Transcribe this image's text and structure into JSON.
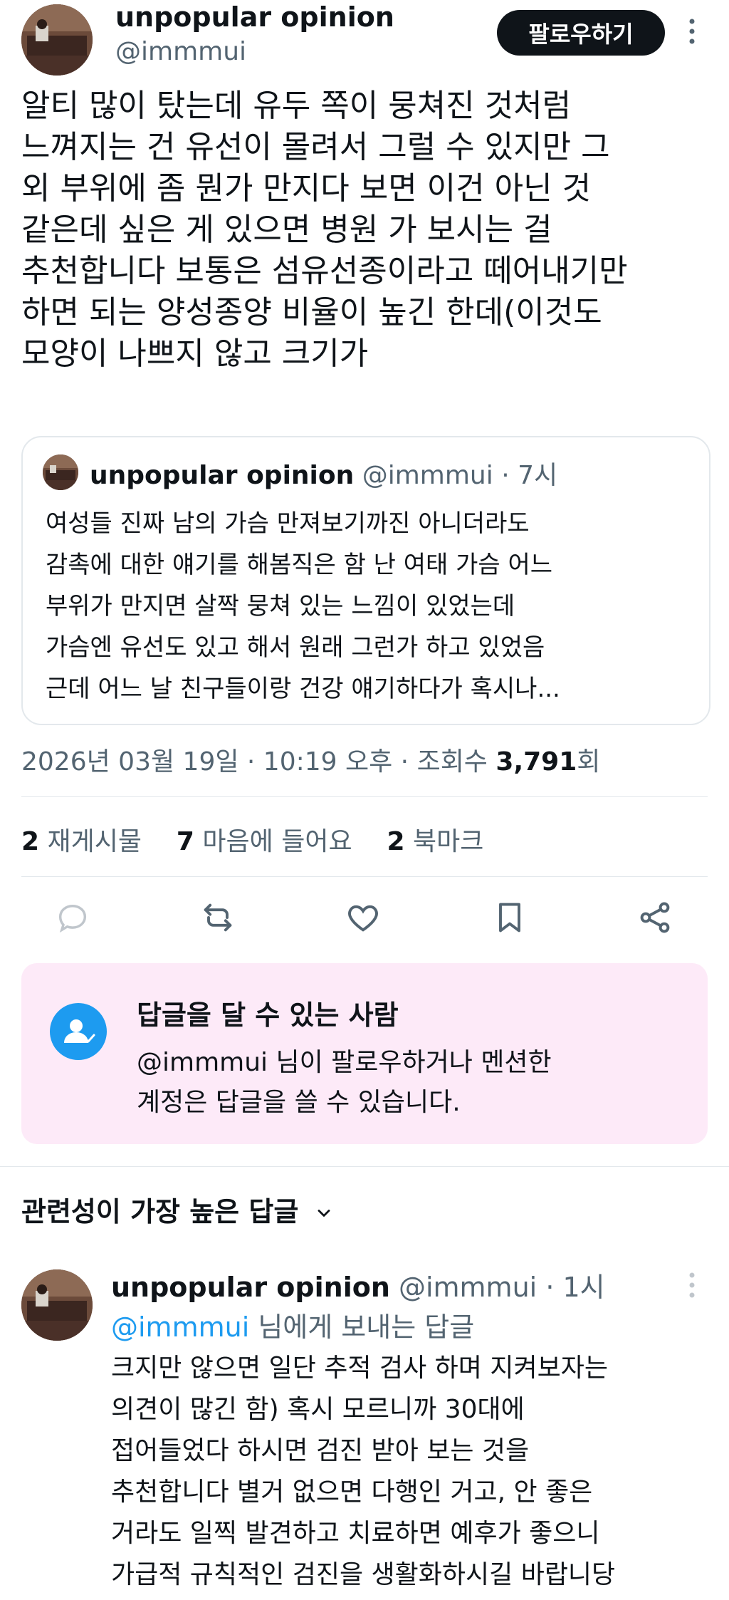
{
  "post": {
    "author_name": "unpopular opinion",
    "author_handle": "@immmui",
    "follow_label": "팔로우하기",
    "text_lines": [
      "알티 많이 탔는데 유두 쪽이 뭉쳐진 것처럼",
      "느껴지는 건 유선이 몰려서 그럴 수 있지만 그",
      "외 부위에 좀 뭔가 만지다 보면 이건 아닌 것",
      "같은데 싶은 게 있으면 병원 가 보시는 걸",
      "추천합니다 보통은 섬유선종이라고 떼어내기만",
      "하면 되는 양성종양 비율이 높긴 한데(이것도",
      "모양이 나쁘지 않고 크기가"
    ],
    "quote": {
      "author_name": "unpopular opinion",
      "author_handle": "@immmui",
      "time": "· 7시",
      "text_lines": [
        "여성들 진짜 남의 가슴 만져보기까진 아니더라도",
        "감촉에 대한 얘기를 해봄직은 함 난 여태 가슴 어느",
        "부위가 만지면 살짝 뭉쳐 있는 느낌이 있었는데",
        "가슴엔 유선도 있고 해서 원래 그런가 하고 있었음",
        "근데 어느 날 친구들이랑 건강 얘기하다가 혹시나..."
      ]
    },
    "timestamp": "2026년 03월 19일 · 10:19 오후 · 조회수",
    "views_count": "3,791",
    "views_suffix": "회",
    "stats": {
      "reposts_count": "2",
      "reposts_label": "재게시물",
      "likes_count": "7",
      "likes_label": "마음에 들어요",
      "bookmarks_count": "2",
      "bookmarks_label": "북마크"
    }
  },
  "reply_restriction": {
    "title": "답글을 달 수 있는 사람",
    "line1": "@immmui 님이 팔로우하거나 멘션한",
    "line2": "계정은 답글을 쓸 수 있습니다."
  },
  "replies_section": {
    "title": "관련성이 가장 높은 답글"
  },
  "reply": {
    "author_name": "unpopular opinion",
    "author_handle": "@immmui",
    "time": "· 1시",
    "replying_to_handle": "@immmui",
    "replying_to_suffix": "님에게 보내는 답글",
    "text_lines": [
      "크지만 않으면 일단 추적 검사 하며 지켜보자는",
      "의견이 많긴 함) 혹시 모르니까 30대에",
      "접어들었다 하시면 검진 받아 보는 것을",
      "추천합니다 별거 없으면 다행인 거고, 안 좋은",
      "거라도 일찍 발견하고 치료하면 예후가 좋으니",
      "가급적 규칙적인 검진을 생활화하시길 바랍니당"
    ]
  },
  "colors": {
    "text": "#0f1419",
    "secondary": "#536471",
    "link": "#1d9bf0",
    "reply_box_bg": "#fdeaf8",
    "follow_bg": "#0f1419"
  }
}
